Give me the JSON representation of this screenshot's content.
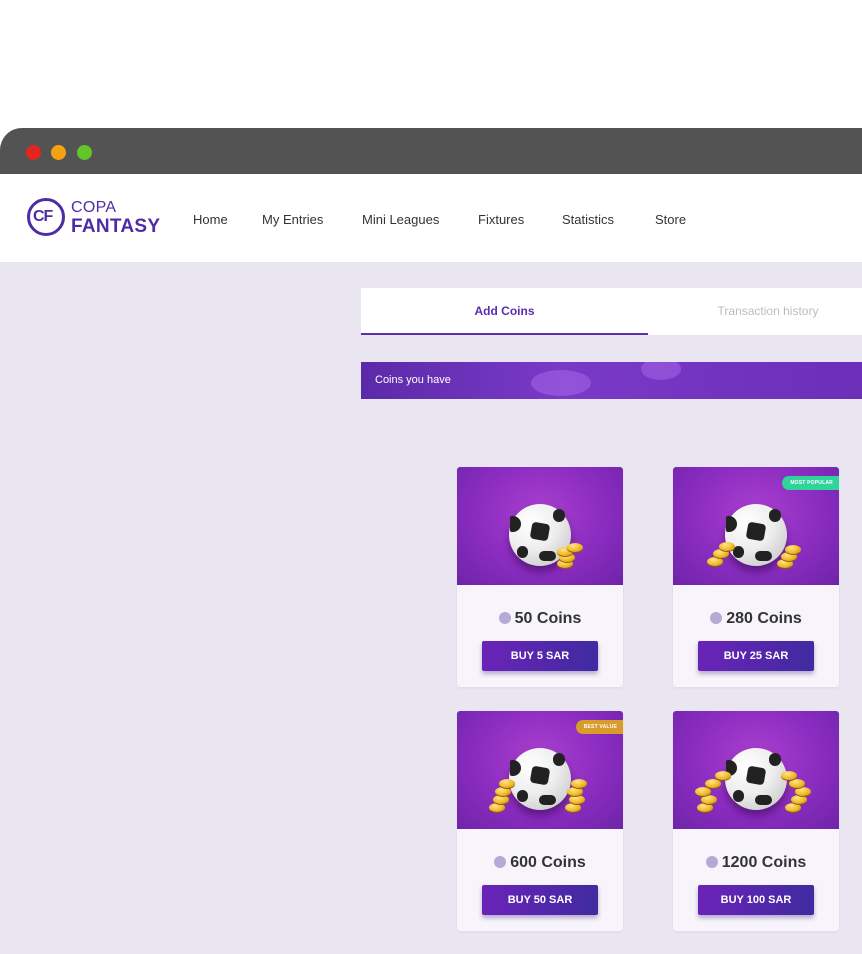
{
  "brand": {
    "line1": "COPA",
    "line2": "FANTASY",
    "mark": "CF"
  },
  "nav": {
    "items": [
      {
        "label": "Home"
      },
      {
        "label": "My Entries"
      },
      {
        "label": "Mini Leagues"
      },
      {
        "label": "Fixtures"
      },
      {
        "label": "Statistics"
      },
      {
        "label": "Store"
      }
    ]
  },
  "tabs": [
    {
      "label": "Add Coins",
      "active": true
    },
    {
      "label": "Transaction history",
      "active": false
    }
  ],
  "coins_bar": {
    "label": "Coins you have"
  },
  "packages": [
    {
      "coins_label": "50 Coins",
      "button": "BUY 5 SAR",
      "badge": ""
    },
    {
      "coins_label": "280 Coins",
      "button": "BUY 25 SAR",
      "badge": "MOST POPULAR"
    },
    {
      "coins_label": "600 Coins",
      "button": "BUY 50 SAR",
      "badge": "BEST VALUE"
    },
    {
      "coins_label": "1200 Coins",
      "button": "BUY 100 SAR",
      "badge": ""
    }
  ],
  "icons": {
    "window_controls": [
      "close-dot",
      "minimize-dot",
      "maximize-dot"
    ],
    "card_image": "soccer-ball-with-coins",
    "coin_icon": "coin-stack-icon"
  },
  "colors": {
    "accent": "#5b2db0",
    "brand": "#4c2da7",
    "page_bg": "#e9e6f2",
    "badge_green": "#2fd49a",
    "badge_gold": "#d99b2a"
  }
}
